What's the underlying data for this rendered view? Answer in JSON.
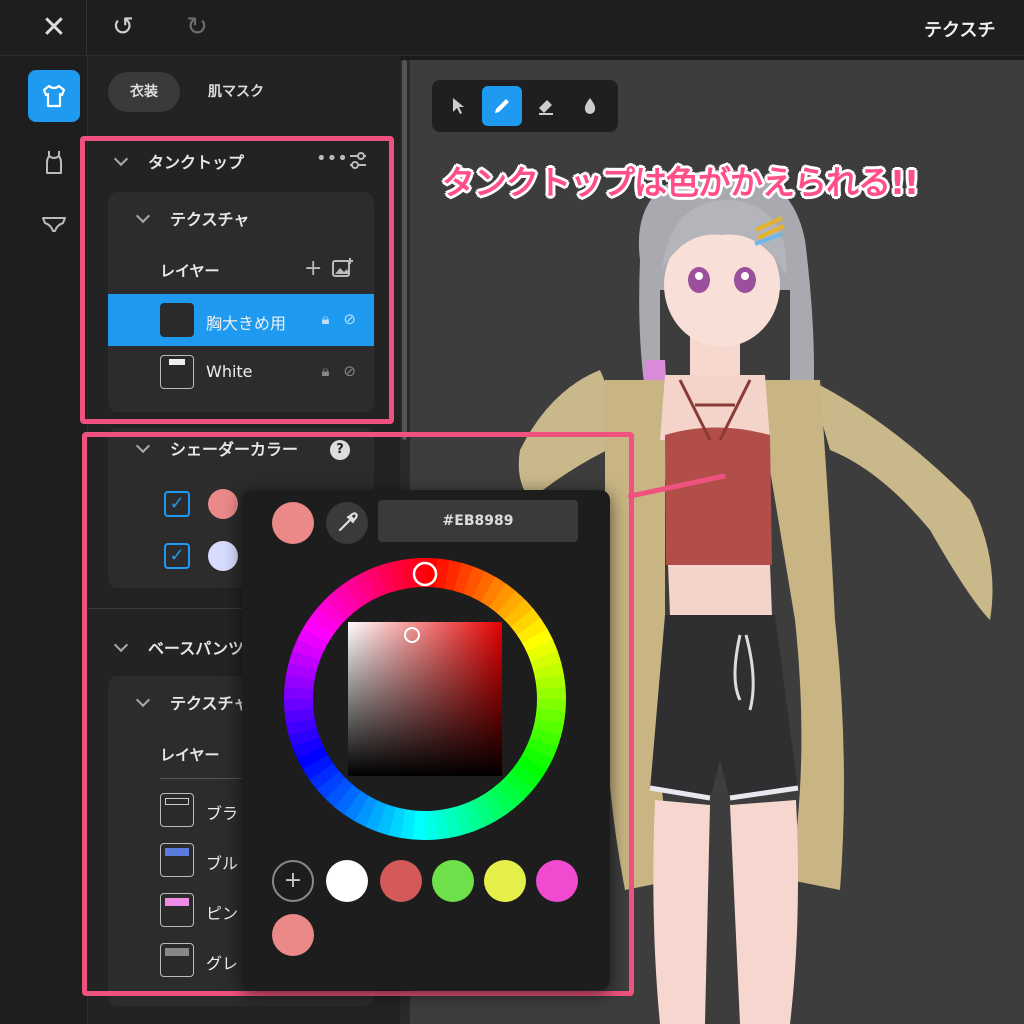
{
  "toolbar": {
    "close_icon": "close-icon",
    "undo_icon": "undo-icon",
    "redo_icon": "redo-icon",
    "title": "テクスチ"
  },
  "rail": {
    "items": [
      {
        "icon": "shirt-icon",
        "active": true
      },
      {
        "icon": "tank-top-icon",
        "active": false
      },
      {
        "icon": "underwear-icon",
        "active": false
      }
    ]
  },
  "panel": {
    "tabs": [
      {
        "label": "衣装",
        "selected": true
      },
      {
        "label": "肌マスク",
        "selected": false
      }
    ],
    "tanktop": {
      "title": "タンクトップ",
      "texture_label": "テクスチャ",
      "layers_label": "レイヤー",
      "layers": [
        {
          "name": "胸大きめ用",
          "selected": true
        },
        {
          "name": "White",
          "selected": false
        }
      ]
    },
    "shader": {
      "title": "シェーダーカラー",
      "colors": [
        {
          "checked": true,
          "color": "#EB8989"
        },
        {
          "checked": true,
          "color": "#D8DCFF"
        }
      ]
    },
    "basepants": {
      "title": "ベースパンツ",
      "texture_label": "テクスチャ",
      "layers_label": "レイヤー",
      "layers": [
        {
          "name": "ブラ"
        },
        {
          "name": "ブル"
        },
        {
          "name": "ピン"
        },
        {
          "name": "グレ"
        }
      ]
    }
  },
  "viewport": {
    "tools": [
      "cursor-icon",
      "pen-icon",
      "eraser-icon",
      "fill-drop-icon"
    ],
    "active_tool": "pen-icon",
    "annotation": "タンクトップは色がかえられる!!"
  },
  "picker": {
    "current_color": "#EB8989",
    "hex": "#EB8989",
    "presets": [
      "#FFFFFF",
      "#D45A5A",
      "#6EE04A",
      "#E6F04A",
      "#F04AD0",
      "#EB8989"
    ],
    "accent": "#1e9bf0",
    "highlight": "#f0527f"
  }
}
